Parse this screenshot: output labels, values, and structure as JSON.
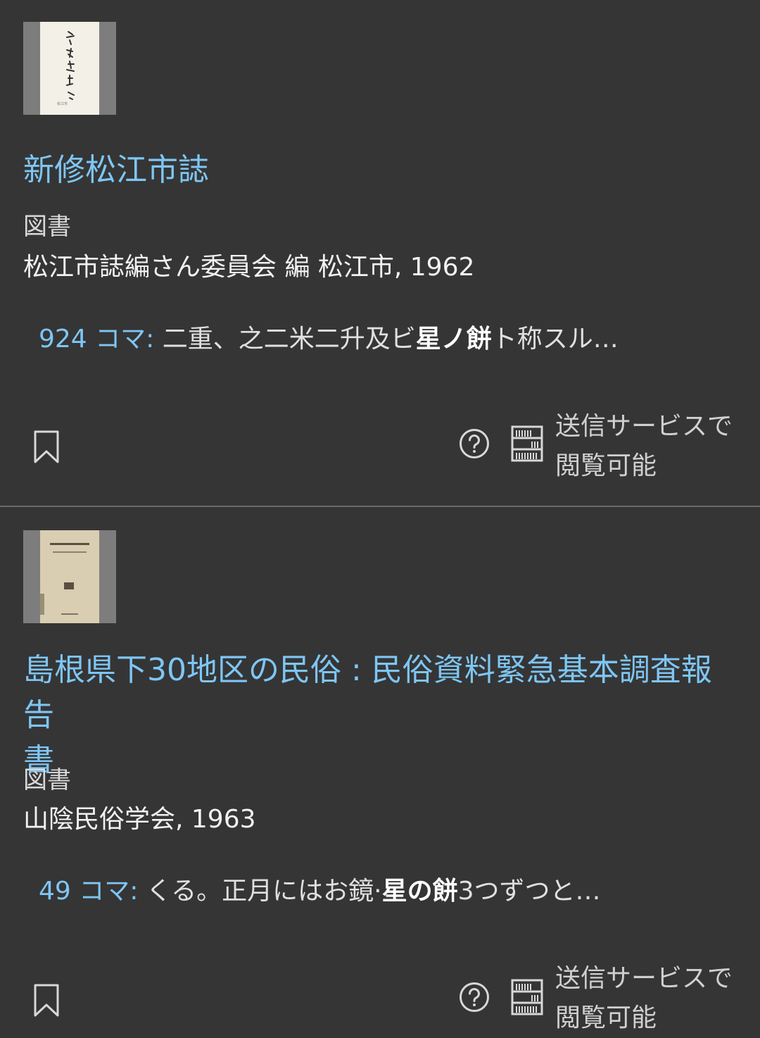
{
  "results": [
    {
      "title": "新修松江市誌",
      "type": "図書",
      "meta": "松江市誌編さん委員会 編 松江市, 1962",
      "snippet": {
        "frame": "924 コマ:",
        "before": " 二重、之二米二升及ビ",
        "highlight": "星ノ餅",
        "after": "ト称スル…"
      },
      "access_line1": "送信サービスで",
      "access_line2": "閲覧可能",
      "icons": [
        "bookmark-icon",
        "help-circle-icon",
        "library-shelf-icon"
      ]
    },
    {
      "title_line1": "島根県下30地区の民俗 : 民俗資料緊急基本調査報告",
      "title_line2": "書",
      "type": "図書",
      "meta": "山陰民俗学会, 1963",
      "snippet": {
        "frame": "49 コマ:",
        "before": " くる。正月にはお鏡·",
        "highlight": "星の餅",
        "after": "3つずつと…"
      },
      "access_line1": "送信サービスで",
      "access_line2": "閲覧可能",
      "icons": [
        "bookmark-icon",
        "help-circle-icon",
        "library-shelf-icon"
      ]
    }
  ]
}
